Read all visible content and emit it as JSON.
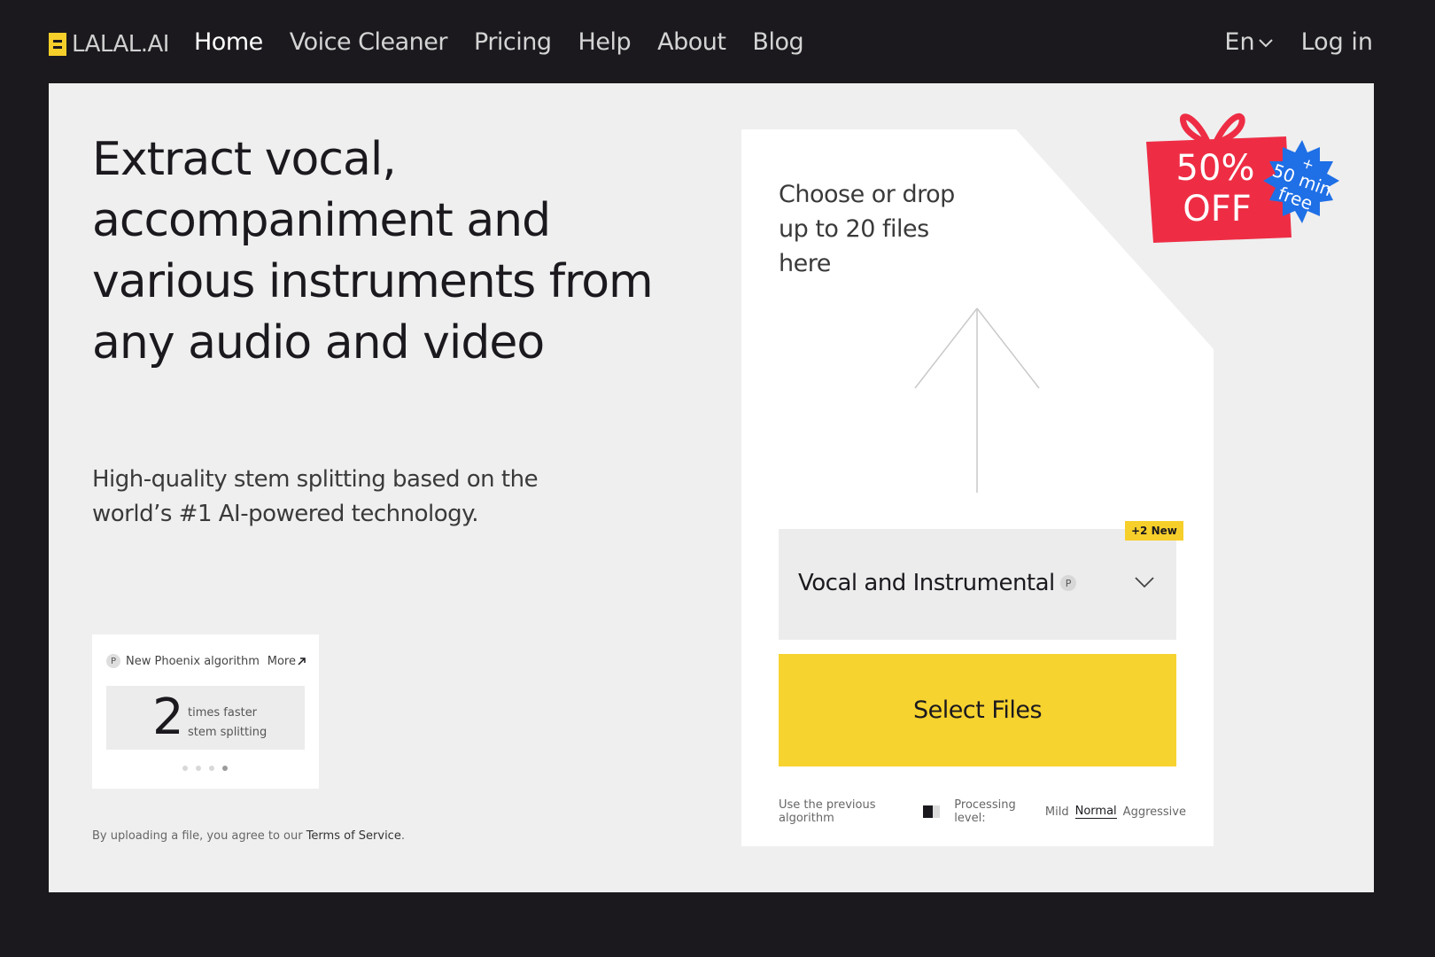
{
  "header": {
    "logo_text": "LALAL.AI",
    "nav": [
      {
        "label": "Home",
        "active": true
      },
      {
        "label": "Voice Cleaner",
        "active": false
      },
      {
        "label": "Pricing",
        "active": false
      },
      {
        "label": "Help",
        "active": false
      },
      {
        "label": "About",
        "active": false
      },
      {
        "label": "Blog",
        "active": false
      }
    ],
    "language": "En",
    "login_label": "Log in"
  },
  "hero": {
    "title": "Extract vocal, accompaniment and various instruments from any audio and video",
    "subtitle": "High-quality stem splitting based on the world’s #1 AI-powered technology."
  },
  "promo_card": {
    "badge_icon": "P",
    "label": "New Phoenix algorithm",
    "more_label": "More",
    "more_icon": "arrow-up-right-icon",
    "number": "2",
    "line1": "times faster",
    "line2": "stem splitting",
    "dots_count": 4,
    "active_dot": 4
  },
  "terms": {
    "prefix": "By uploading a file, you agree to our ",
    "link": "Terms of Service",
    "suffix": "."
  },
  "upload": {
    "drop_text": "Choose or drop up to 20 files here",
    "new_badge": "+2 New",
    "algorithm": "Vocal and Instrumental",
    "algorithm_icon": "P",
    "select_button": "Select Files",
    "previous_algorithm_label": "Use the previous algorithm",
    "processing_label": "Processing level:",
    "levels": [
      "Mild",
      "Normal",
      "Aggressive"
    ],
    "active_level": "Normal"
  },
  "sale": {
    "percent": "50%",
    "off": "OFF",
    "burst_plus": "+",
    "burst_minutes": "50 min",
    "burst_free": "free"
  },
  "colors": {
    "background": "#1b191e",
    "panel": "#efefef",
    "accent_yellow": "#f7d330",
    "sale_red": "#ee2d45",
    "burst_blue": "#1f6fe6"
  }
}
